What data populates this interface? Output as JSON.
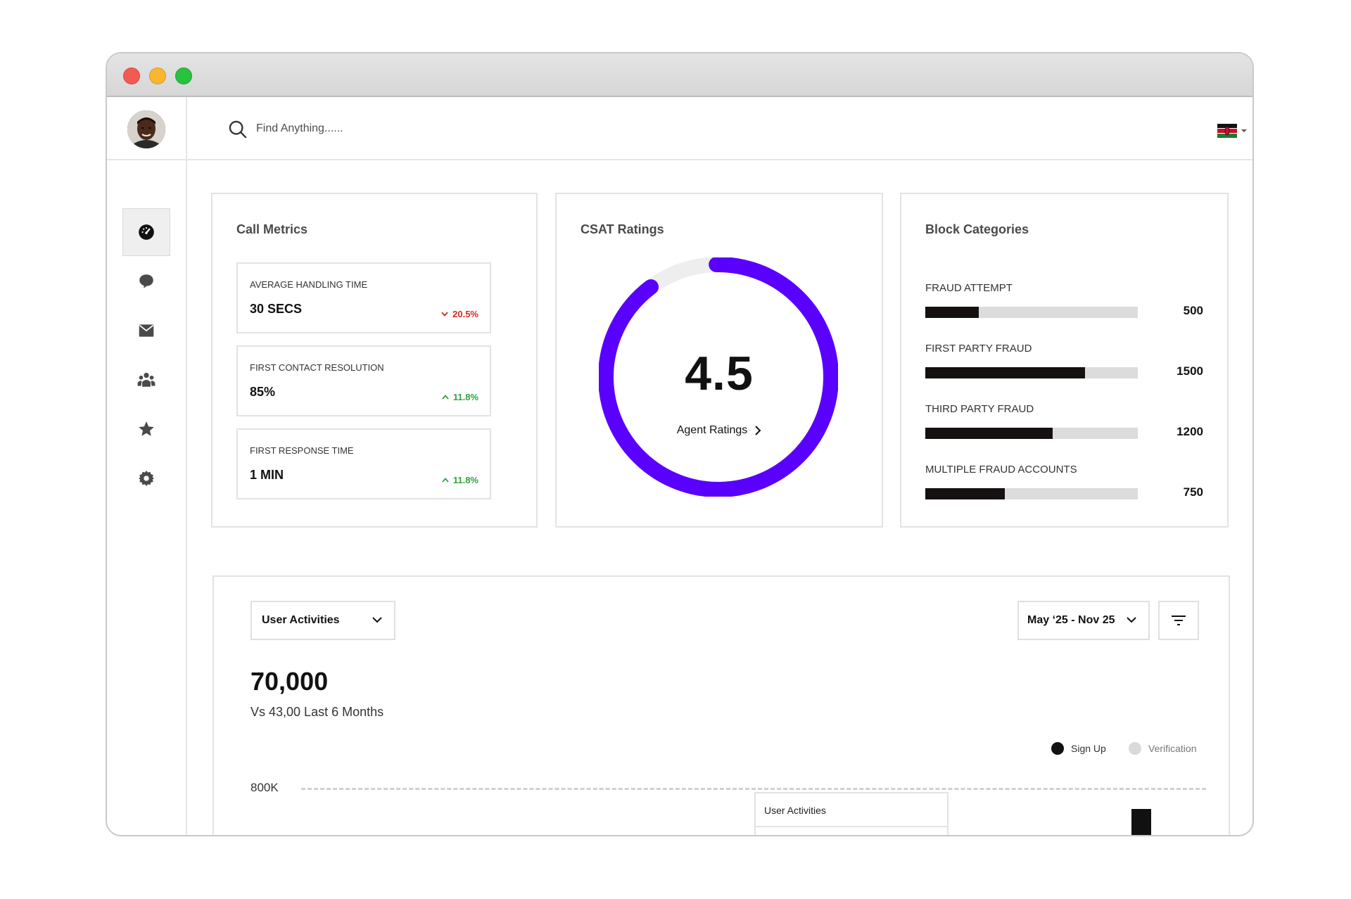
{
  "app": {
    "window_controls": [
      "close",
      "minimize",
      "maximize"
    ]
  },
  "sidebar": {
    "items": [
      {
        "name": "dashboard",
        "icon": "dashboard-icon",
        "active": true
      },
      {
        "name": "messages",
        "icon": "chat-bubble-icon",
        "active": false
      },
      {
        "name": "mail",
        "icon": "mail-icon",
        "active": false
      },
      {
        "name": "users",
        "icon": "users-icon",
        "active": false
      },
      {
        "name": "favorites",
        "icon": "star-icon",
        "active": false
      },
      {
        "name": "settings",
        "icon": "gear-icon",
        "active": false
      }
    ]
  },
  "header": {
    "search_placeholder": "Find Anything......",
    "language_flag": "flag-kenya-icon",
    "notifications_icon": "bell-icon"
  },
  "call_metrics": {
    "title": "Call Metrics",
    "items": [
      {
        "label": "AVERAGE HANDLING TIME",
        "value": "30 SECS",
        "delta": "20.5%",
        "trend": "down"
      },
      {
        "label": "FIRST CONTACT RESOLUTION",
        "value": "85%",
        "delta": "11.8%",
        "trend": "up"
      },
      {
        "label": "FIRST RESPONSE TIME",
        "value": "1 MIN",
        "delta": "11.8%",
        "trend": "up"
      }
    ]
  },
  "csat": {
    "title": "CSAT Ratings",
    "value": "4.5",
    "max": 5,
    "link_label": "Agent Ratings",
    "accent_color": "#5a00ff",
    "track_color": "#eeeeee"
  },
  "block_categories": {
    "title": "Block Categories",
    "scale_max": 2000,
    "items": [
      {
        "label": "FRAUD ATTEMPT",
        "value": 500,
        "display": "500"
      },
      {
        "label": "FIRST PARTY FRAUD",
        "value": 1500,
        "display": "1500"
      },
      {
        "label": "THIRD PARTY FRAUD",
        "value": 1200,
        "display": "1200"
      },
      {
        "label": "MULTIPLE FRAUD ACCOUNTS",
        "value": 750,
        "display": "750"
      }
    ]
  },
  "activities": {
    "select_label": "User Activities",
    "date_range": "May ‘25  - Nov 25",
    "filter_icon": "filter-icon",
    "total": "70,000",
    "comparison": "Vs 43,00 Last 6 Months",
    "legend": [
      {
        "label": "Sign Up",
        "color": "#111111"
      },
      {
        "label": "Verification",
        "color": "#d9d9d9"
      }
    ],
    "y_tick": "800K",
    "tooltip_title": "User Activities"
  }
}
